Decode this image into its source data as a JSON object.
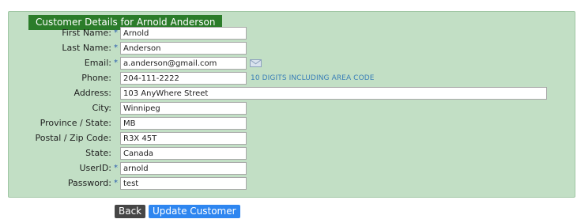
{
  "panel": {
    "title": "Customer Details for Arnold Anderson"
  },
  "form": {
    "first_name": {
      "label": "First Name:",
      "value": "Arnold",
      "required": true
    },
    "last_name": {
      "label": "Last Name:",
      "value": "Anderson",
      "required": true
    },
    "email": {
      "label": "Email:",
      "value": "a.anderson@gmail.com",
      "required": true,
      "icon": "envelope-icon"
    },
    "phone": {
      "label": "Phone:",
      "value": "204-111-2222",
      "hint": "10 DIGITS INCLUDING AREA CODE"
    },
    "address": {
      "label": "Address:",
      "value": "103 AnyWhere Street"
    },
    "city": {
      "label": "City:",
      "value": "Winnipeg"
    },
    "province": {
      "label": "Province / State:",
      "value": "MB"
    },
    "postal": {
      "label": "Postal / Zip Code:",
      "value": "R3X 45T"
    },
    "state": {
      "label": "State:",
      "value": "Canada"
    },
    "userid": {
      "label": "UserID:",
      "value": "arnold",
      "required": true
    },
    "password": {
      "label": "Password:",
      "value": "test",
      "required": true
    }
  },
  "required_marker": "*",
  "buttons": {
    "back": "Back",
    "update": "Update Customer"
  },
  "colors": {
    "panel_bg": "#c2dfc5",
    "title_bg": "#2b7c2a",
    "hint": "#3a7fb7",
    "required": "#2a5db0",
    "back_btn": "#464646",
    "update_btn": "#2e86f0"
  }
}
